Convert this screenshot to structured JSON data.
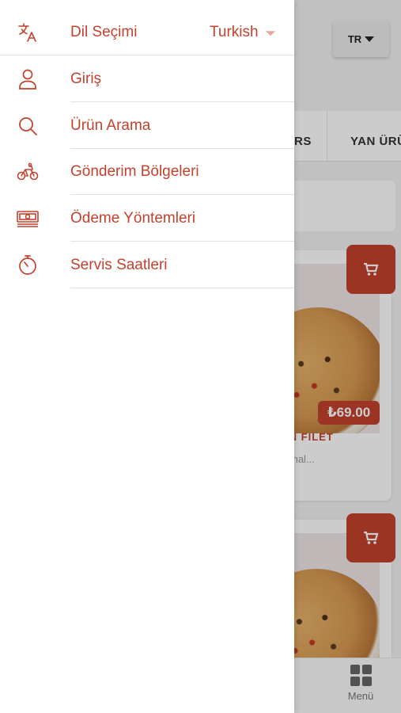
{
  "background": {
    "language_button": "TR",
    "category_tabs": [
      "RS",
      "YAN ÜRÜ"
    ],
    "product": {
      "price": "₺69.00",
      "title": "EN FILET",
      "description": "mal..."
    },
    "bottom_nav": {
      "menu_label": "Menü"
    }
  },
  "drawer": {
    "language": {
      "label": "Dil Seçimi",
      "value": "Turkish",
      "icon": "translate-icon"
    },
    "items": [
      {
        "label": "Giriş",
        "icon": "user-icon"
      },
      {
        "label": "Ürün Arama",
        "icon": "search-icon"
      },
      {
        "label": "Gönderim Bölgeleri",
        "icon": "bicycle-icon"
      },
      {
        "label": "Ödeme Yöntemleri",
        "icon": "cash-icon"
      },
      {
        "label": "Servis Saatleri",
        "icon": "timer-icon"
      }
    ]
  },
  "colors": {
    "accent": "#c4412d",
    "overlay": "rgba(0,0,0,0.2)"
  }
}
